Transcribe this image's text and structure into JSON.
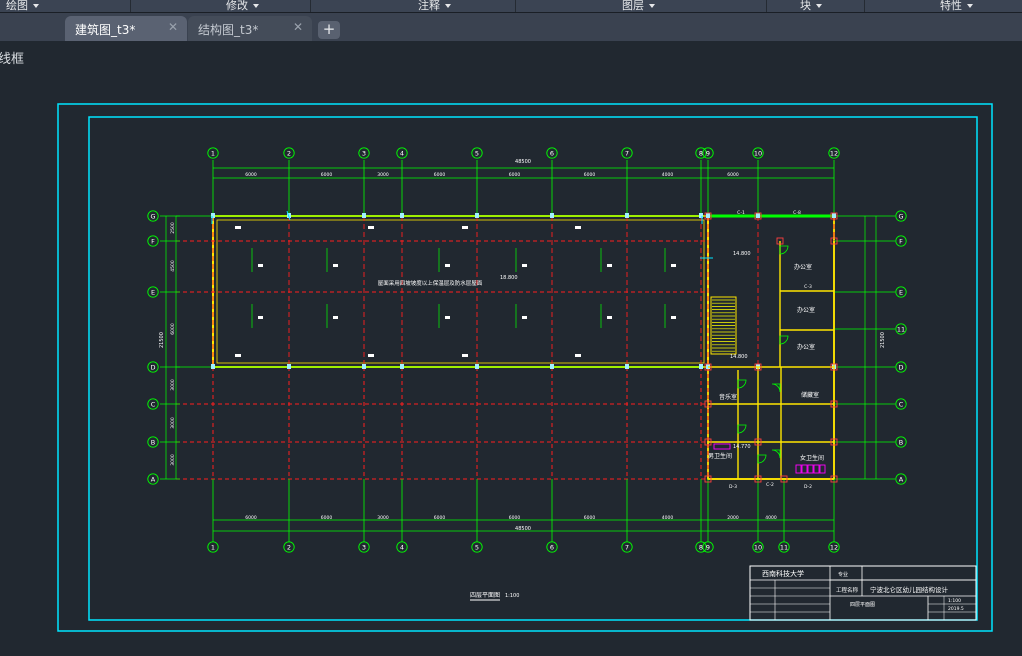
{
  "menu": [
    {
      "label": "绘图"
    },
    {
      "label": "修改"
    },
    {
      "label": "注释"
    },
    {
      "label": "图层"
    },
    {
      "label": "块"
    },
    {
      "label": "特性"
    }
  ],
  "tabs": [
    {
      "label": "建筑图_t3*",
      "active": true
    },
    {
      "label": "结构图_t3*",
      "active": false
    }
  ],
  "new_tab_label": "+",
  "viewport_label": "线框",
  "colors": {
    "canvas": "#212830",
    "frame": "#00e5ff",
    "axis": "#00ff00",
    "slab_grid": "#ff1e1e",
    "wall": "#ffe600",
    "text": "#ffffff",
    "stairs": "#ffff00",
    "fixtures": "#ff00ff"
  },
  "drawing": {
    "grid_top": [
      "1",
      "2",
      "3",
      "4",
      "5",
      "6",
      "7",
      "8",
      "9",
      "10",
      "12"
    ],
    "grid_bottom": [
      "1",
      "2",
      "3",
      "4",
      "5",
      "6",
      "7",
      "8",
      "9",
      "10",
      "11",
      "12"
    ],
    "grid_left": [
      "G",
      "F",
      "E",
      "D",
      "C",
      "B",
      "A"
    ],
    "grid_right": [
      "G",
      "F",
      "E",
      "11",
      "D",
      "C",
      "B",
      "A"
    ],
    "dims_top": [
      "6000",
      "6000",
      "3000",
      "6000",
      "6000",
      "6000",
      "4000",
      "6000"
    ],
    "dims_bottom": [
      "6000",
      "6000",
      "3000",
      "6000",
      "6000",
      "6000",
      "4000",
      "2000",
      "4000"
    ],
    "total_dim": "48500",
    "left_dims": [
      "2500",
      "4500",
      "6000",
      "3000",
      "3000",
      "3000"
    ],
    "left_total": "21500",
    "slab_note": "屋面采用四坡坡度以上保温层及防水层屋面",
    "elevation_roof": "18.800",
    "elevation_top": "14.800",
    "elevation_stair": "14.800",
    "elevation_wc": "14.770",
    "rooms": [
      {
        "label": "办公室"
      },
      {
        "label": "办公室"
      },
      {
        "label": "办公室"
      },
      {
        "label": "音乐室"
      },
      {
        "label": "储藏室"
      },
      {
        "label": "男卫生间"
      },
      {
        "label": "女卫生间"
      }
    ],
    "door_tags": [
      "C-1",
      "C-8",
      "C-3",
      "D-3",
      "C-2",
      "D-2"
    ],
    "plan_title": "四层平面图",
    "plan_scale": "1:100",
    "title_block": {
      "school": "西南科技大学",
      "project_label": "工程名称",
      "project": "宁波北仑区幼儿园结构设计",
      "major": "专业",
      "sheet": "四层平面图",
      "scale": "1:100",
      "date": "2019.5"
    }
  }
}
